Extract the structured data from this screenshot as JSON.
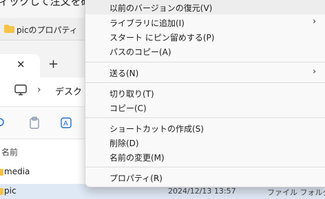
{
  "document": {
    "partial_text": "ィックして注文を確"
  },
  "properties_window": {
    "title": "picのプロパティ"
  },
  "explorer": {
    "tab_close": "✕",
    "new_tab": "+",
    "breadcrumb_chevron": "›",
    "breadcrumb_partial": "デスクト",
    "column_name_header": "名前",
    "files": [
      {
        "name": "media",
        "date": "",
        "type": ""
      },
      {
        "name": "pic",
        "date": "2024/12/13 13:57",
        "type": "ファイル フォルダー"
      }
    ]
  },
  "context_menu": {
    "items": [
      {
        "label": "以前のバージョンの復元(V)",
        "highlighted": true
      },
      {
        "label": "ライブラリに追加(I)",
        "has_submenu": true,
        "arrow": "›"
      },
      {
        "label": "スタート にピン留めする(P)"
      },
      {
        "label": "パスのコピー(A)"
      },
      {
        "label": "送る(N)",
        "has_submenu": true,
        "arrow": "›"
      },
      {
        "label": "切り取り(T)"
      },
      {
        "label": "コピー(C)"
      },
      {
        "label": "ショートカットの作成(S)"
      },
      {
        "label": "削除(D)"
      },
      {
        "label": "名前の変更(M)"
      },
      {
        "label": "プロパティ(R)"
      }
    ]
  },
  "colors": {
    "folder_yellow": "#f6c343",
    "selection_blue": "#dfe8f5",
    "icon_blue": "#1f6fd1"
  }
}
